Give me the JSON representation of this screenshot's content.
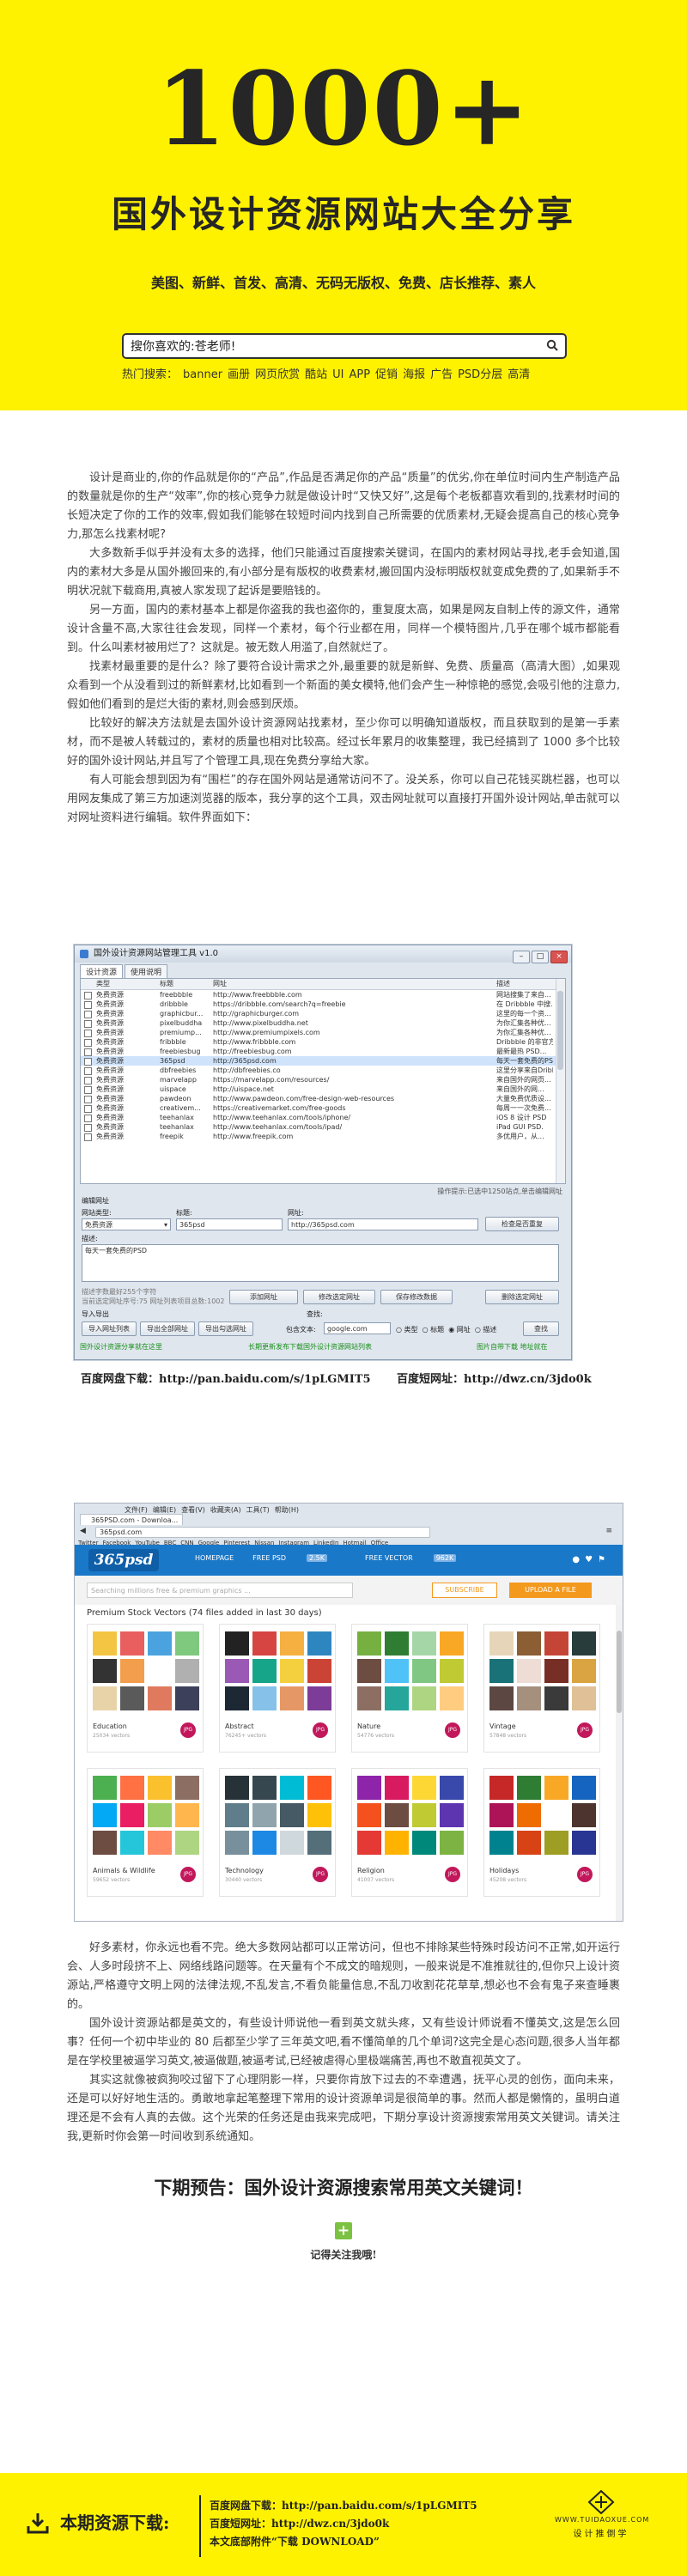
{
  "hero": {
    "big": "1000+",
    "title": "国外设计资源网站大全分享",
    "tags": "美图、新鲜、首发、高清、无码无版权、免费、店长推荐、素人",
    "search_value": "搜你喜欢的:苍老师!",
    "hot_label": "热门搜索：",
    "hot_words": [
      "banner",
      "画册",
      "网页欣赏",
      "酷站",
      "UI",
      "APP",
      "促销",
      "海报",
      "广告",
      "PSD分层",
      "高清"
    ]
  },
  "article1": [
    "设计是商业的,你的作品就是你的“产品”,作品是否满足你的产品“质量”的优劣,你在单位时间内生产制造产品的数量就是你的生产“效率”,你的核心竞争力就是做设计时“又快又好”,这是每个老板都喜欢看到的,找素材时间的长短决定了你的工作的效率,假如我们能够在较短时间内找到自己所需要的优质素材,无疑会提高自己的核心竞争力,那怎么找素材呢?",
    "大多数新手似乎并没有太多的选择，他们只能通过百度搜索关键词，在国内的素材网站寻找,老手会知道,国内的素材大多是从国外搬回来的,有小部分是有版权的收费素材,搬回国内没标明版权就变成免费的了,如果新手不明状况就下载商用,真被人家发现了起诉是要赔钱的。",
    "另一方面，国内的素材基本上都是你盗我的我也盗你的，重复度太高，如果是网友自制上传的源文件，通常设计含量不高,大家往往会发现，同样一个素材，每个行业都在用，同样一个模特图片,几乎在哪个城市都能看到。什么叫素材被用烂了？这就是。被无数人用滥了,自然就烂了。",
    "找素材最重要的是什么？除了要符合设计需求之外,最重要的就是新鲜、免费、质量高（高清大图）,如果观众看到一个从没看到过的新鲜素材,比如看到一个新面的美女模特,他们会产生一种惊艳的感觉,会吸引他的注意力,假如他们看到的是烂大街的素材,则会感到厌烦。",
    "比较好的解决方法就是去国外设计资源网站找素材，至少你可以明确知道版权，而且获取到的是第一手素材，而不是被人转载过的，素材的质量也相对比较高。经过长年累月的收集整理，我已经搞到了 1000 多个比较好的国外设计网站,并且写了个管理工具,现在免费分享给大家。",
    "有人可能会想到因为有“围栏”的存在国外网站是通常访问不了。没关系，你可以自己花钱买跳栏器，也可以用网友集成了第三方加速浏览器的版本，我分享的这个工具，双击网址就可以直接打开国外设计网站,单击就可以对网址资料进行编辑。软件界面如下："
  ],
  "tool": {
    "title": "国外设计资源网站管理工具 v1.0",
    "tabs": [
      "设计资源",
      "使用说明"
    ],
    "columns": [
      "类型",
      "标题",
      "网址",
      "描述"
    ],
    "rows": [
      [
        "免费资源",
        "freebbble",
        "http://www.freebbble.com",
        "网站搜集了来自..."
      ],
      [
        "免费资源",
        "dribbble",
        "https://dribbble.com/search?q=freebie",
        "在 Dribbble 中搜..."
      ],
      [
        "免费资源",
        "graphicbur...",
        "http://graphicburger.com",
        "这里的每一个资..."
      ],
      [
        "免费资源",
        "pixelbuddha",
        "http://www.pixelbuddha.net",
        "为你汇集各种优..."
      ],
      [
        "免费资源",
        "premiump...",
        "http://www.premiumpixels.com",
        "为你汇集各种优..."
      ],
      [
        "免费资源",
        "fribbble",
        "http://www.fribbble.com",
        "Dribbble 的非官方..."
      ],
      [
        "免费资源",
        "freebiesbug",
        "http://freebiesbug.com",
        "最新最热 PSD..."
      ],
      [
        "免费资源",
        "365psd",
        "http://365psd.com",
        "每天一套免费的PSD"
      ],
      [
        "免费资源",
        "dbfreebies",
        "http://dbfreebies.co",
        "这里分享来自Dribb..."
      ],
      [
        "免费资源",
        "marvelapp",
        "https://marvelapp.com/resources/",
        "来自国外的网页..."
      ],
      [
        "免费资源",
        "uispace",
        "http://uispace.net",
        "来自国外的网..."
      ],
      [
        "免费资源",
        "pawdeon",
        "http://www.pawdeon.com/free-design-web-resources",
        "大量免费优质设..."
      ],
      [
        "免费资源",
        "creativem...",
        "https://creativemarket.com/free-goods",
        "每周一一次免费..."
      ],
      [
        "免费资源",
        "teehanlax",
        "http://www.teehanlax.com/tools/iphone/",
        "iOS 8 设计 PSD"
      ],
      [
        "免费资源",
        "teehanlax",
        "http://www.teehanlax.com/tools/ipad/",
        "iPad GUI PSD."
      ],
      [
        "免费资源",
        "freepik",
        "http://www.freepik.com",
        "多优用户，从..."
      ]
    ],
    "status": "操作提示:已选中1250站点,单击编辑网址",
    "edit_label": "编辑网址",
    "type_label": "网站类型:",
    "title_label": "标题:",
    "url_label": "网址:",
    "type_value": "免费资源",
    "title_value": "365psd",
    "url_value": "http://365psd.com",
    "check_btn": "检查是否重复",
    "desc_label": "描述:",
    "desc_value": "每天一套免费的PSD",
    "count_hint": "描述字数最好255个字符",
    "total_hint": "当前选定网址序号:75  网址列表项目总数:1002",
    "add_btn": "添加网址",
    "modify_btn": "修改选定网址",
    "save_btn": "保存修改数据",
    "delete_btn": "删除选定网址",
    "import_label": "导入导出",
    "search_label": "查找:",
    "import_btn": "导入网址列表",
    "export_all_btn": "导出全部网址",
    "export_sel_btn": "导出勾选网址",
    "contains_label": "包含文本:",
    "search_value": "google.com",
    "radio_type": "类型",
    "radio_title": "标题",
    "radio_url": "网址",
    "radio_desc": "描述",
    "find_btn": "查找",
    "footer_left": "国外设计资源分享就在这里",
    "footer_mid": "长期更新发布下载国外设计资源网站列表",
    "footer_right": "图片自带下载 地址就在"
  },
  "links": {
    "pan_label": "百度网盘下载：",
    "pan_url": "http://pan.baidu.com/s/1pLGMIT5",
    "short_label": "百度短网址：",
    "short_url": "http://dwz.cn/3jdo0k"
  },
  "browser": {
    "menus": [
      "文件(F)",
      "编辑(E)",
      "查看(V)",
      "收藏夹(A)",
      "工具(T)",
      "帮助(H)"
    ],
    "tab": "365PSD.com - Downloa...",
    "url": "365psd.com",
    "bookmarks": [
      "Twitter",
      "Facebook",
      "YouTube",
      "BBC",
      "CNN",
      "Google",
      "Pinterest",
      "Nissan",
      "Instagram",
      "LinkedIn",
      "Hotmail",
      "Office"
    ],
    "logo": "365psd",
    "nav": [
      "HOMEPAGE",
      "FREE PSD",
      "FREE VECTOR"
    ],
    "psd_badge": "2.5K",
    "vector_badge": "962K",
    "search_placeholder": "Searching millions free & premium graphics ...",
    "subscribe": "SUBSCRIBE",
    "upload": "UPLOAD A FILE",
    "heading": "Premium Stock Vectors (74 files added in last 30 days)",
    "cards": [
      {
        "name": "Education",
        "count": "25034 vectors",
        "author": "JPG"
      },
      {
        "name": "Abstract",
        "count": "76245+ vectors",
        "author": "JPG"
      },
      {
        "name": "Nature",
        "count": "54776 vectors",
        "author": "JPG"
      },
      {
        "name": "Vintage",
        "count": "57848 vectors",
        "author": "JPG"
      },
      {
        "name": "Animals & Wildlife",
        "count": "59652 vectors",
        "author": "JPG"
      },
      {
        "name": "Technology",
        "count": "30440 vectors",
        "author": "JPG"
      },
      {
        "name": "Religion",
        "count": "41007 vectors",
        "author": "JPG"
      },
      {
        "name": "Holidays",
        "count": "45208 vectors",
        "author": "JPG"
      }
    ]
  },
  "article2": [
    "好多素材，你永远也看不完。绝大多数网站都可以正常访问，但也不排除某些特殊时段访问不正常,如开运行会、人多时段挤不上、网络线路问题等。在天量有个不成文的暗规则，一般来说是不准推就往的,但你只上设计资源站,严格遵守文明上网的法律法规,不乱发言,不看负能量信息,不乱刀收割花花草草,想必也不会有鬼子来查睡裹的。",
    "国外设计资源站都是英文的，有些设计师说他一看到英文就头疼，又有些设计师说看不懂英文,这是怎么回事？任何一个初中毕业的 80 后都至少学了三年英文吧,看不懂简单的几个单词?这完全是心态问题,很多人当年都是在学校里被逼学习英文,被逼做题,被逼考试,已经被虐得心里极端痛苦,再也不敢直视英文了。",
    "其实这就像被疯狗咬过留下了心理阴影一样，只要你肯放下过去的不幸遭遇，抚平心灵的创伤，面向未来，还是可以好好地生活的。勇敢地拿起笔整理下常用的设计资源单词是很简单的事。然而人都是懒惰的，虽明白道理还是不会有人真的去做。这个光荣的任务还是由我来完成吧，下期分享设计资源搜索常用英文关键词。请关注我,更新时你会第一时间收到系统通知。"
  ],
  "next_preview": "下期预告：国外设计资源搜索常用英文关键词！",
  "remember": "记得关注我哦!",
  "footer": {
    "label": "本期资源下载:",
    "pan": "百度网盘下载：http://pan.baidu.com/s/1pLGMIT5",
    "short": "百度短网址：http://dwz.cn/3jdo0k",
    "attach": "本文底部附件“下载 DOWNLOAD”",
    "site": "WWW.TUIDAOXUE.COM",
    "cn": "设计推倒学"
  },
  "colors": {
    "brand_yellow": "#fff200",
    "nav_blue": "#1a78c8",
    "accent_orange": "#f39a1e",
    "green": "#7cc242"
  }
}
